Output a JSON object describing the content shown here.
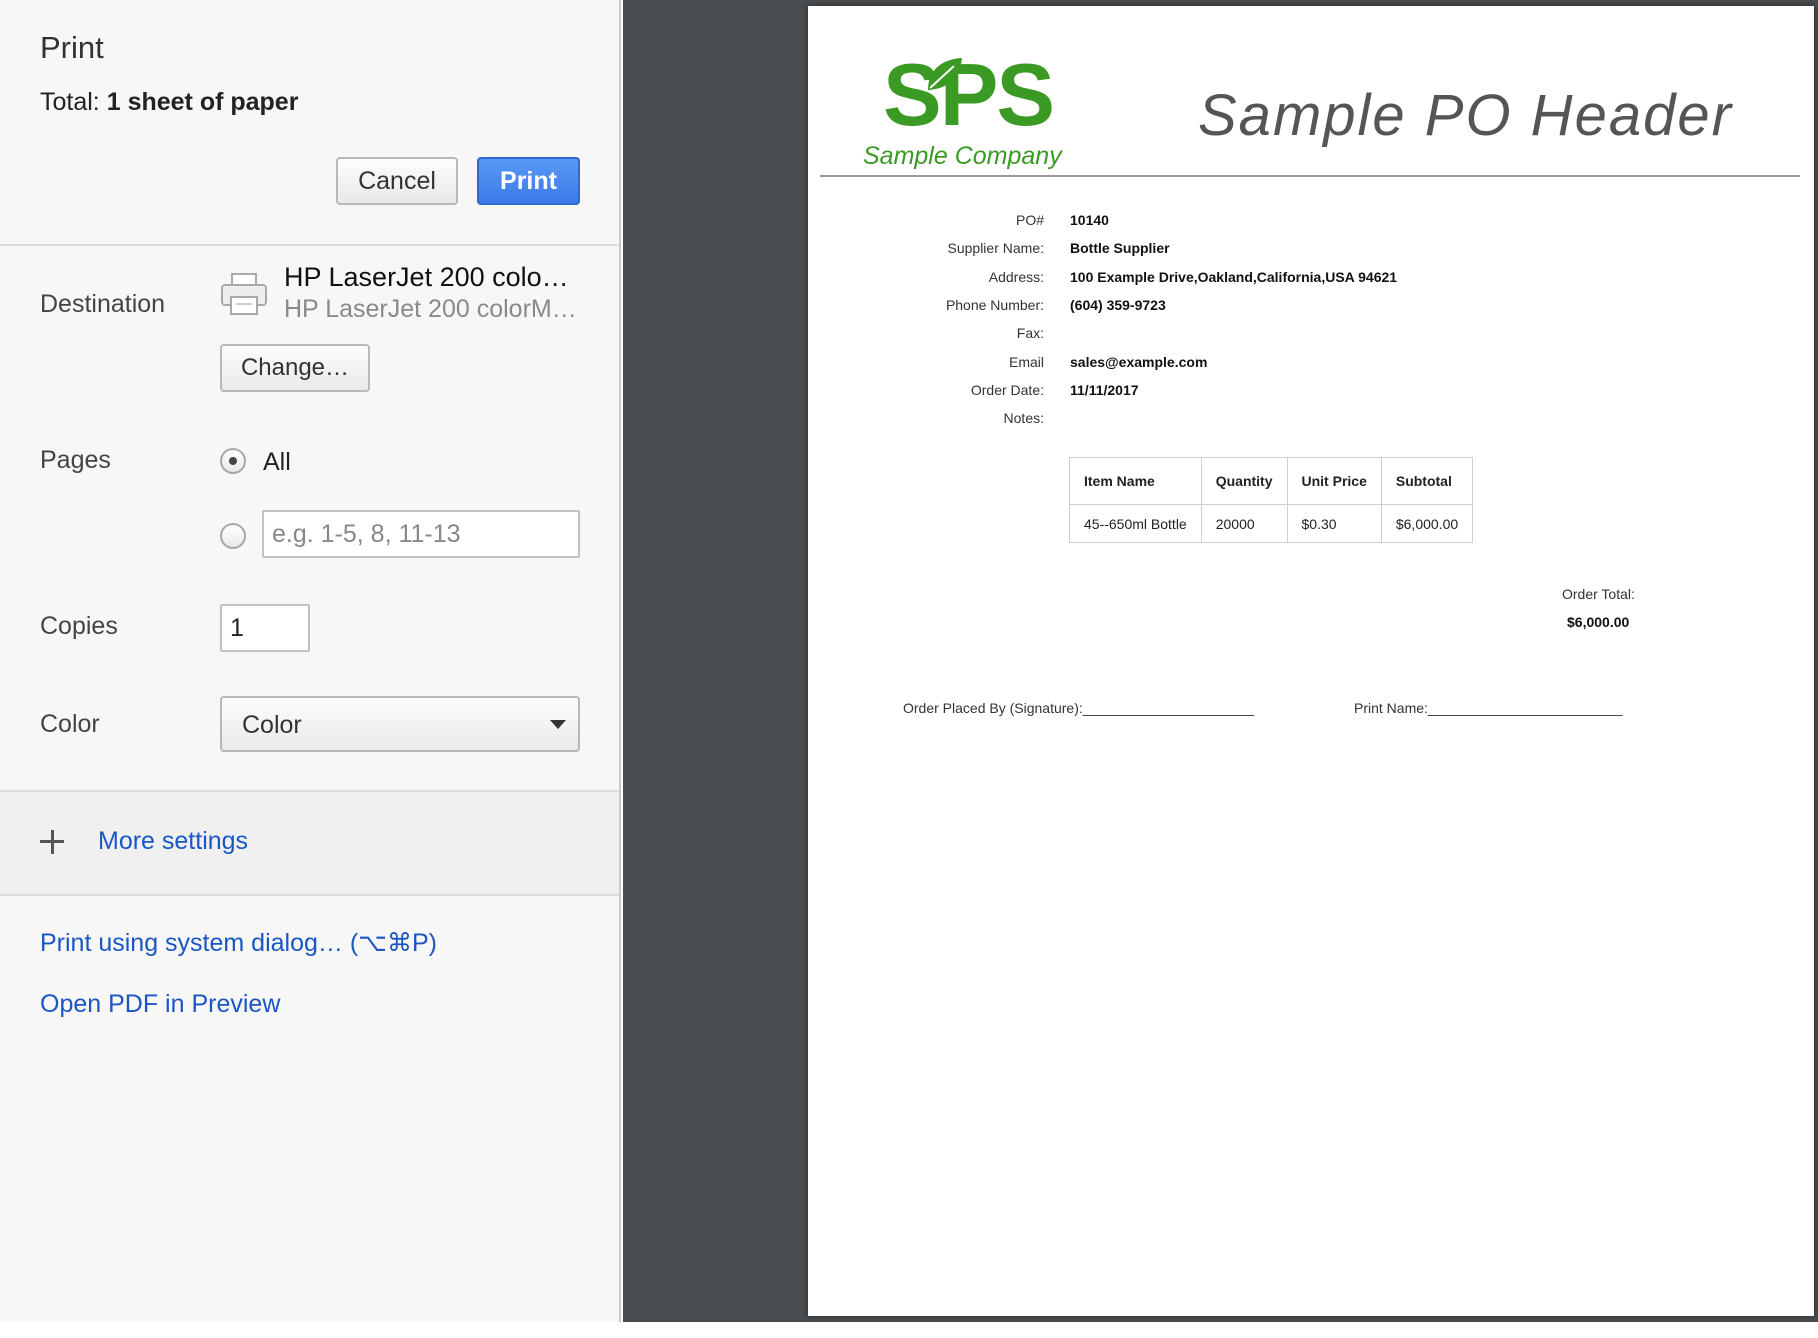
{
  "dialog": {
    "title": "Print",
    "total_label": "Total:",
    "total_value": "1 sheet of paper",
    "cancel_label": "Cancel",
    "print_label": "Print"
  },
  "destination": {
    "label": "Destination",
    "printer_name": "HP LaserJet 200 colo…",
    "printer_subtitle": "HP LaserJet 200 colorM…",
    "change_label": "Change…"
  },
  "pages": {
    "label": "Pages",
    "all_label": "All",
    "custom_placeholder": "e.g. 1-5, 8, 11-13",
    "selected": "All"
  },
  "copies": {
    "label": "Copies",
    "value": "1"
  },
  "color": {
    "label": "Color",
    "value": "Color"
  },
  "more_settings": {
    "label": "More settings"
  },
  "links": {
    "system_dialog": "Print using system dialog… (⌥⌘P)",
    "open_pdf": "Open PDF in Preview"
  },
  "document": {
    "logo_letters": "SPS",
    "logo_company": "Sample Company",
    "header": "Sample PO Header",
    "fields": [
      {
        "label": "PO#",
        "value": "10140"
      },
      {
        "label": "Supplier Name:",
        "value": "Bottle Supplier"
      },
      {
        "label": "Address:",
        "value": "100 Example Drive,Oakland,California,USA 94621"
      },
      {
        "label": "Phone Number:",
        "value": "(604) 359-9723"
      },
      {
        "label": "Fax:",
        "value": ""
      },
      {
        "label": "Email",
        "value": "sales@example.com"
      },
      {
        "label": "Order Date:",
        "value": "11/11/2017"
      },
      {
        "label": "Notes:",
        "value": ""
      }
    ],
    "table": {
      "headers": [
        "Item Name",
        "Quantity",
        "Unit Price",
        "Subtotal"
      ],
      "rows": [
        [
          "45--650ml Bottle",
          "20000",
          "$0.30",
          "$6,000.00"
        ]
      ]
    },
    "order_total_label": "Order Total:",
    "order_total_value": "$6,000.00",
    "signature_label": "Order Placed By (Signature):______________________",
    "print_name_label": "Print Name:_________________________"
  },
  "colors": {
    "accent_blue": "#3b7be8",
    "link_blue": "#1a56c4",
    "logo_green": "#3a9a23",
    "preview_bg": "#4a4d50"
  }
}
